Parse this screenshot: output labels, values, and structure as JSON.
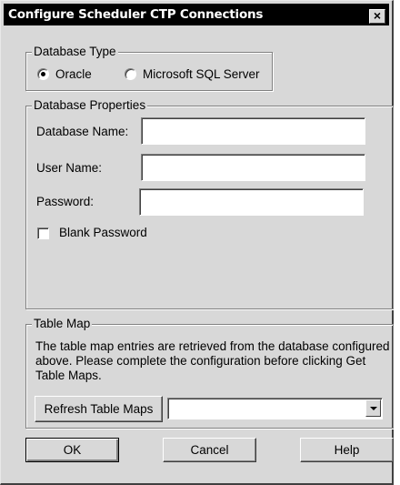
{
  "window": {
    "title": "Configure Scheduler CTP Connections",
    "close_glyph": "×"
  },
  "database_type": {
    "legend": "Database Type",
    "options": [
      {
        "label": "Oracle",
        "selected": true
      },
      {
        "label": "Microsoft SQL Server",
        "selected": false
      }
    ]
  },
  "database_properties": {
    "legend": "Database Properties",
    "database_name_label": "Database Name:",
    "database_name_value": "",
    "user_name_label": "User Name:",
    "user_name_value": "",
    "password_label": "Password:",
    "password_value": "",
    "blank_password_label": "Blank Password",
    "blank_password_checked": false
  },
  "table_map": {
    "legend": "Table Map",
    "description": "The table map entries are retrieved from the database configured above. Please complete the configuration before clicking Get Table Maps.",
    "refresh_button": "Refresh Table Maps",
    "selected_value": ""
  },
  "footer": {
    "ok": "OK",
    "cancel": "Cancel",
    "help": "Help"
  }
}
